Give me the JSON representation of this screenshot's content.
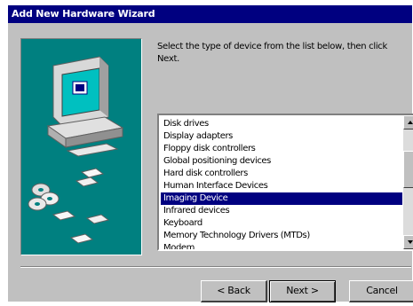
{
  "window": {
    "title": "Add New Hardware Wizard"
  },
  "instruction": "Select the type of device from the list below, then click Next.",
  "device_list": {
    "items": [
      "Disk drives",
      "Display adapters",
      "Floppy disk controllers",
      "Global positioning devices",
      "Hard disk controllers",
      "Human Interface Devices",
      "Imaging Device",
      "Infrared devices",
      "Keyboard",
      "Memory Technology Drivers (MTDs)",
      "Modem"
    ],
    "selected_index": 6
  },
  "buttons": {
    "back": "< Back",
    "next": "Next >",
    "cancel": "Cancel"
  },
  "colors": {
    "titlebar": "#000080",
    "art_background": "#008080",
    "selection": "#000080",
    "dialog": "#c0c0c0"
  },
  "icons": {
    "art": "computer-with-disks-illustration",
    "scroll_up": "arrow-up-icon",
    "scroll_down": "arrow-down-icon"
  }
}
